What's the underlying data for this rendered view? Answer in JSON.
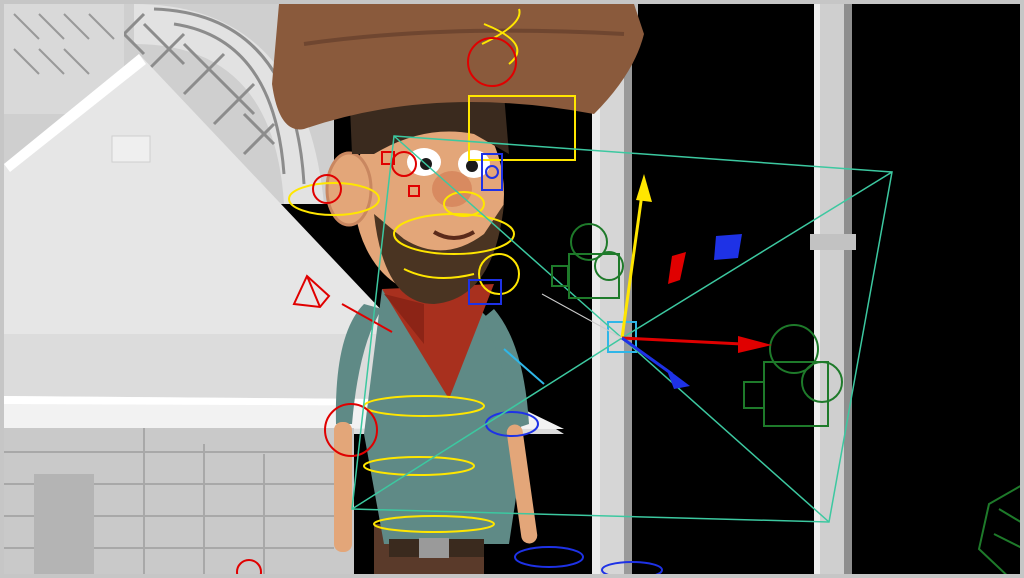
{
  "viewport": {
    "label": "",
    "background_color": "#000000",
    "frame_color": "#c6c6c6"
  },
  "scene": {
    "set_color": "#d8d8d8",
    "set_shadow_color": "#9a9a9a",
    "hat_color": "#8a5a3c",
    "skin_color": "#e3a679",
    "shirt_color": "#5f8a86",
    "bandana_color": "#a8301e",
    "hair_color": "#3a2a1e",
    "camera_frustum_color": "#3cc8a0",
    "control_colors": {
      "yellow": "#ffe600",
      "red": "#e00000",
      "blue": "#1e32e6",
      "cyan": "#2fb6e8",
      "green": "#1e7a2a"
    },
    "manipulator_icons": [
      "move-y-arrow-icon",
      "move-x-arrow-icon",
      "move-z-arrow-icon",
      "plane-handle-icon"
    ]
  }
}
